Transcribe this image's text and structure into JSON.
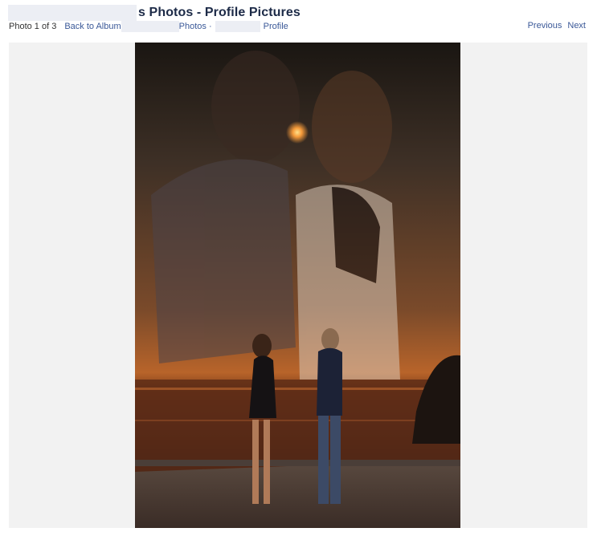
{
  "header": {
    "title": "s Photos - Profile Pictures"
  },
  "nav": {
    "photo_count": "Photo 1 of 3",
    "back_link": "Back to Album",
    "photos_link": "Photos ·",
    "profile_link": "Profile",
    "previous": "Previous",
    "next": "Next"
  },
  "colors": {
    "link": "#3b5998",
    "title": "#1c2a47",
    "stage_bg": "#f2f2f2"
  }
}
